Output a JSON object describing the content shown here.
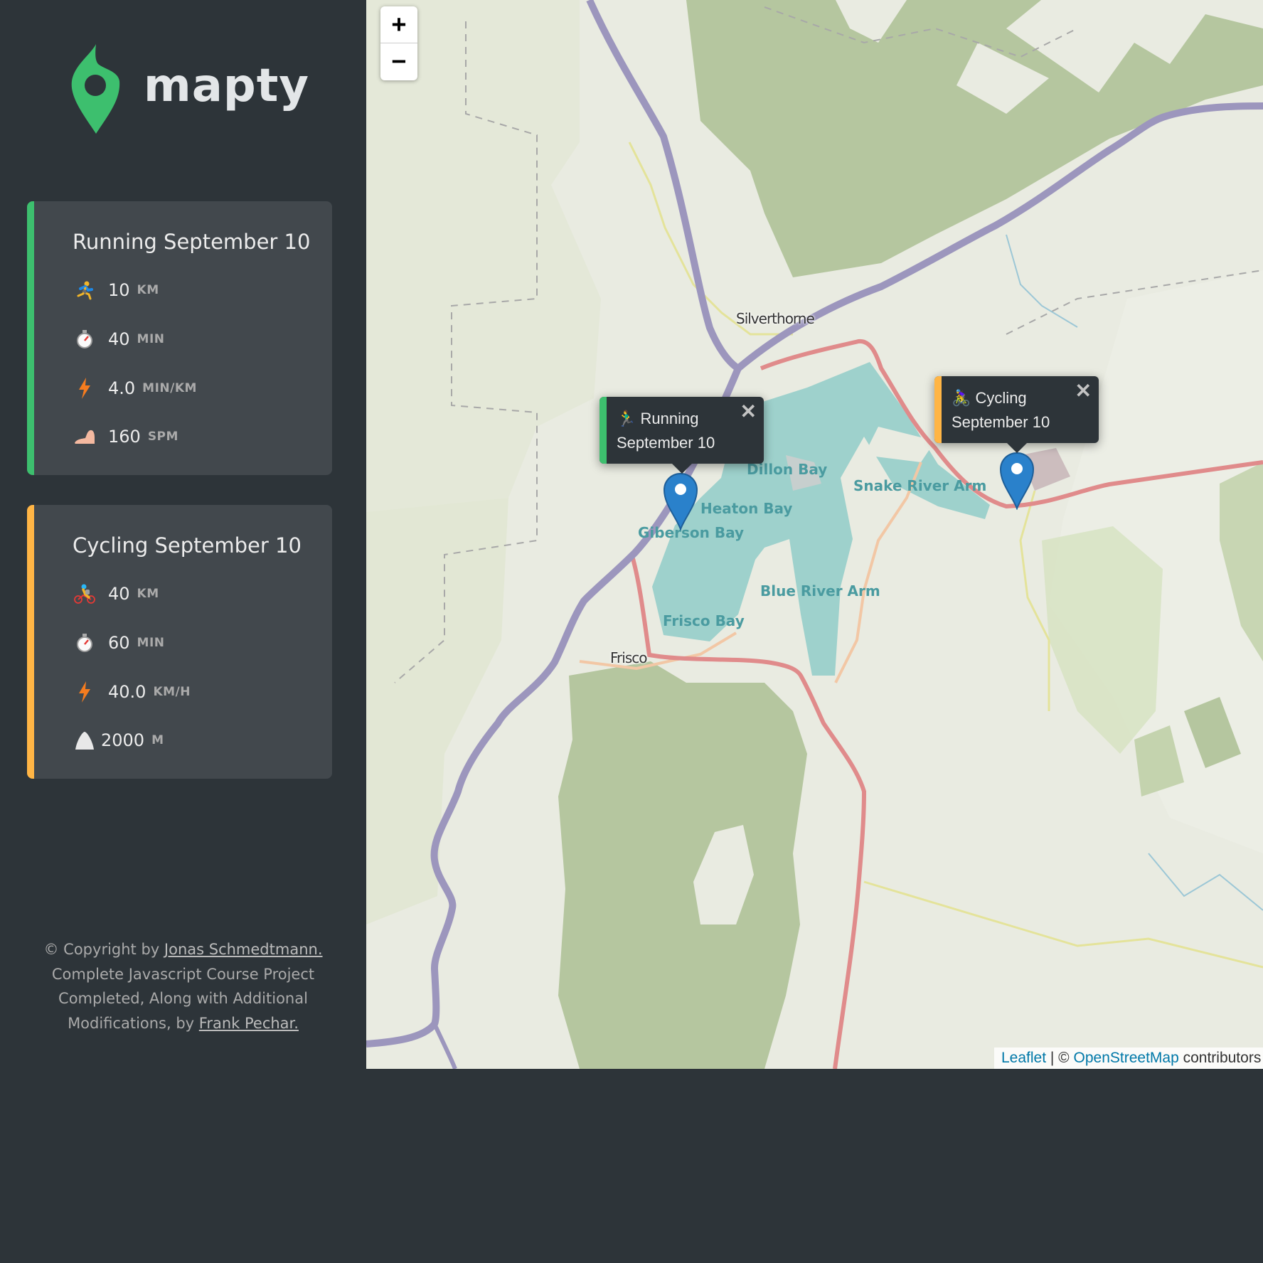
{
  "app": {
    "name": "mapty"
  },
  "colors": {
    "running": "#3dbf6e",
    "cycling": "#ffb545",
    "sidebar_bg": "#2d3439",
    "card_bg": "#42484d",
    "marker": "#2a81cb"
  },
  "workouts": [
    {
      "type": "running",
      "title": "Running September 10",
      "details": [
        {
          "icon": "running-person-icon",
          "value": "10",
          "unit": "KM"
        },
        {
          "icon": "stopwatch-icon",
          "value": "40",
          "unit": "MIN"
        },
        {
          "icon": "lightning-icon",
          "value": "4.0",
          "unit": "MIN/KM"
        },
        {
          "icon": "foot-icon",
          "value": "160",
          "unit": "SPM"
        }
      ]
    },
    {
      "type": "cycling",
      "title": "Cycling September 10",
      "details": [
        {
          "icon": "cyclist-icon",
          "value": "40",
          "unit": "KM"
        },
        {
          "icon": "stopwatch-icon",
          "value": "60",
          "unit": "MIN"
        },
        {
          "icon": "lightning-icon",
          "value": "40.0",
          "unit": "KM/H"
        },
        {
          "icon": "mountain-icon",
          "value": "2000",
          "unit": "M"
        }
      ]
    }
  ],
  "footer": {
    "prefix": "© Copyright by ",
    "author_link": "Jonas Schmedtmann.",
    "middle": " Complete Javascript Course Project Completed, Along with Additional Modifications, by ",
    "modifier_link": "Frank Pechar."
  },
  "map": {
    "zoom_in": "+",
    "zoom_out": "−",
    "popups": [
      {
        "type": "running",
        "emoji": "🏃‍♂️",
        "line1": "Running",
        "line2": "September 10",
        "close": "✕"
      },
      {
        "type": "cycling",
        "emoji": "🚴‍♀️",
        "line1": "Cycling",
        "line2": "September 10",
        "close": "✕"
      }
    ],
    "labels": {
      "silverthorne": "Silverthorne",
      "dillon_bay": "Dillon Bay",
      "snake_river_arm": "Snake River Arm",
      "heaton_bay": "Heaton Bay",
      "giberson_bay": "Giberson Bay",
      "blue_river_arm": "Blue River Arm",
      "frisco_bay": "Frisco Bay",
      "frisco": "Frisco"
    },
    "attribution": {
      "leaflet": "Leaflet",
      "separator": " | © ",
      "osm": "OpenStreetMap",
      "suffix": " contributors"
    }
  }
}
